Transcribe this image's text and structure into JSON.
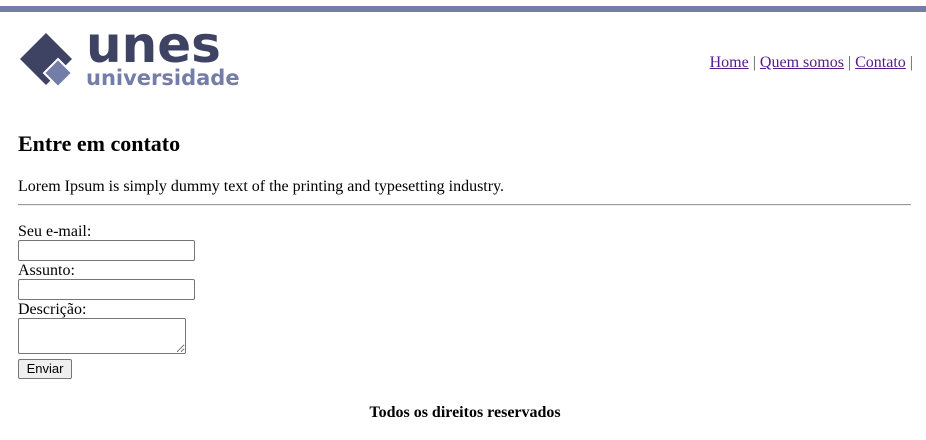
{
  "brand": {
    "name": "unes",
    "subtitle": "universidade",
    "primary_color": "#3e4263",
    "accent_color": "#747da8"
  },
  "nav": {
    "items": [
      {
        "label": "Home",
        "icon": ""
      },
      {
        "label": "Quem somos",
        "icon": ""
      },
      {
        "label": "Contato",
        "icon": ""
      }
    ],
    "separator": "|"
  },
  "main": {
    "title": "Entre em contato",
    "intro": "Lorem Ipsum is simply dummy text of the printing and typesetting industry."
  },
  "form": {
    "email_label": "Seu e-mail:",
    "email_value": "",
    "subject_label": "Assunto:",
    "subject_value": "",
    "description_label": "Descrição:",
    "description_value": "",
    "submit_label": "Enviar"
  },
  "footer": {
    "text": "Todos os direitos reservados"
  }
}
